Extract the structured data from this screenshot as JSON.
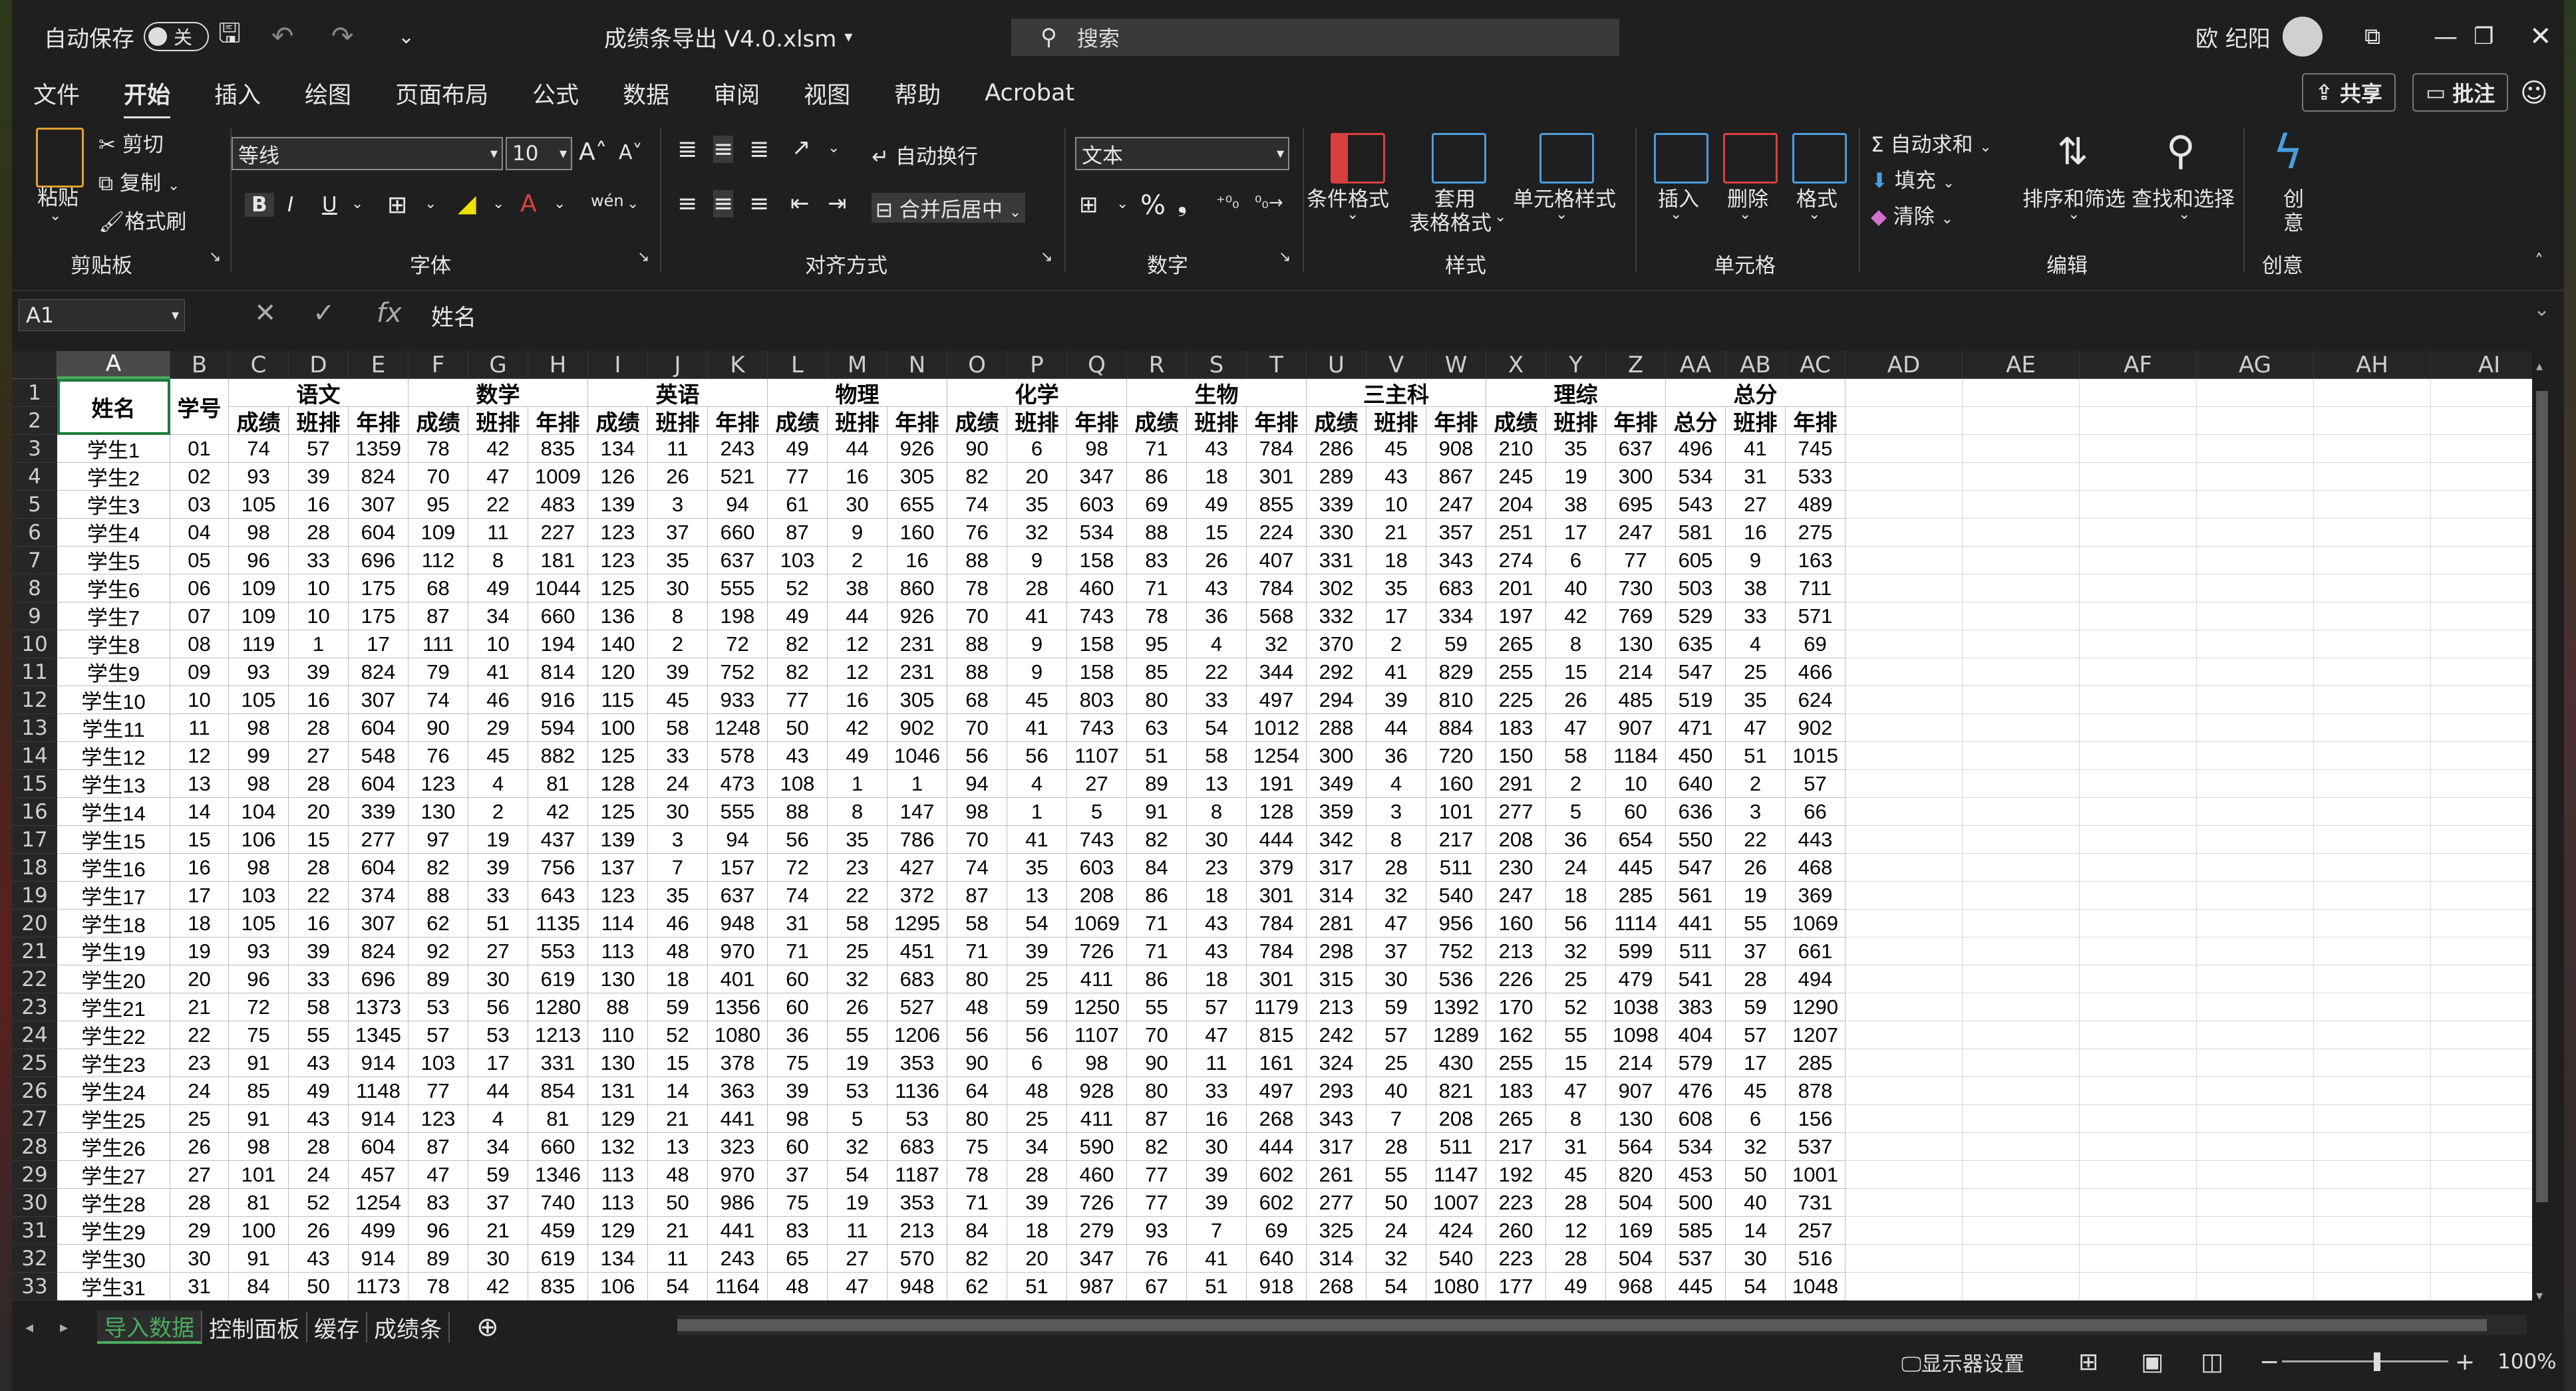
{
  "title_bar": {
    "autosave_label": "自动保存",
    "autosave_state": "关",
    "file_name": "成绩条导出 V4.0.xlsm",
    "search_placeholder": "搜索",
    "user_name": "欧 纪阳"
  },
  "menu": {
    "items": [
      "文件",
      "开始",
      "插入",
      "绘图",
      "页面布局",
      "公式",
      "数据",
      "审阅",
      "视图",
      "帮助",
      "Acrobat"
    ],
    "active": "开始",
    "share_label": "共享",
    "comments_label": "批注"
  },
  "ribbon": {
    "clipboard": {
      "paste": "粘贴",
      "cut": "剪切",
      "copy": "复制",
      "format_painter": "格式刷",
      "group": "剪贴板"
    },
    "font": {
      "name": "等线",
      "size": "10",
      "bold": "B",
      "italic": "I",
      "underline": "U",
      "phonetic": "wén",
      "group": "字体"
    },
    "alignment": {
      "wrap_text": "自动换行",
      "merge_center": "合并后居中",
      "group": "对齐方式"
    },
    "number": {
      "format": "文本",
      "percent": "%",
      "group": "数字"
    },
    "styles": {
      "conditional": "条件格式",
      "table_1": "套用",
      "table_2": "表格格式",
      "cell_styles": "单元格样式",
      "group": "样式"
    },
    "cells": {
      "insert": "插入",
      "delete": "删除",
      "format": "格式",
      "group": "单元格"
    },
    "editing": {
      "autosum": "自动求和",
      "fill": "填充",
      "clear": "清除",
      "sort_filter": "排序和筛选",
      "find_select": "查找和选择",
      "group": "编辑"
    },
    "creative": {
      "label_1": "创",
      "label_2": "意",
      "group": "创意"
    }
  },
  "formula_bar": {
    "cell_ref": "A1",
    "content": "姓名"
  },
  "columns": [
    "A",
    "B",
    "C",
    "D",
    "E",
    "F",
    "G",
    "H",
    "I",
    "J",
    "K",
    "L",
    "M",
    "N",
    "O",
    "P",
    "Q",
    "R",
    "S",
    "T",
    "U",
    "V",
    "W",
    "X",
    "Y",
    "Z",
    "AA",
    "AB",
    "AC",
    "AD",
    "AE",
    "AF",
    "AG",
    "AH",
    "AI"
  ],
  "row_numbers": [
    "1",
    "2",
    "3",
    "4",
    "5",
    "6",
    "7",
    "8",
    "9",
    "10",
    "11",
    "12",
    "13",
    "14",
    "15",
    "16",
    "17",
    "18",
    "19",
    "20",
    "21",
    "22",
    "23",
    "24",
    "25",
    "26",
    "27",
    "28",
    "29",
    "30",
    "31",
    "32",
    "33"
  ],
  "table": {
    "name_header": "姓名",
    "id_header": "学号",
    "subjects": [
      "语文",
      "数学",
      "英语",
      "物理",
      "化学",
      "生物",
      "三主科",
      "理综",
      "总分"
    ],
    "subheaders": [
      [
        "成绩",
        "班排",
        "年排"
      ],
      [
        "成绩",
        "班排",
        "年排"
      ],
      [
        "成绩",
        "班排",
        "年排"
      ],
      [
        "成绩",
        "班排",
        "年排"
      ],
      [
        "成绩",
        "班排",
        "年排"
      ],
      [
        "成绩",
        "班排",
        "年排"
      ],
      [
        "成绩",
        "班排",
        "年排"
      ],
      [
        "成绩",
        "班排",
        "年排"
      ],
      [
        "总分",
        "班排",
        "年排"
      ]
    ],
    "rows": [
      [
        "学生1",
        "01",
        "74",
        "57",
        "1359",
        "78",
        "42",
        "835",
        "134",
        "11",
        "243",
        "49",
        "44",
        "926",
        "90",
        "6",
        "98",
        "71",
        "43",
        "784",
        "286",
        "45",
        "908",
        "210",
        "35",
        "637",
        "496",
        "41",
        "745"
      ],
      [
        "学生2",
        "02",
        "93",
        "39",
        "824",
        "70",
        "47",
        "1009",
        "126",
        "26",
        "521",
        "77",
        "16",
        "305",
        "82",
        "20",
        "347",
        "86",
        "18",
        "301",
        "289",
        "43",
        "867",
        "245",
        "19",
        "300",
        "534",
        "31",
        "533"
      ],
      [
        "学生3",
        "03",
        "105",
        "16",
        "307",
        "95",
        "22",
        "483",
        "139",
        "3",
        "94",
        "61",
        "30",
        "655",
        "74",
        "35",
        "603",
        "69",
        "49",
        "855",
        "339",
        "10",
        "247",
        "204",
        "38",
        "695",
        "543",
        "27",
        "489"
      ],
      [
        "学生4",
        "04",
        "98",
        "28",
        "604",
        "109",
        "11",
        "227",
        "123",
        "37",
        "660",
        "87",
        "9",
        "160",
        "76",
        "32",
        "534",
        "88",
        "15",
        "224",
        "330",
        "21",
        "357",
        "251",
        "17",
        "247",
        "581",
        "16",
        "275"
      ],
      [
        "学生5",
        "05",
        "96",
        "33",
        "696",
        "112",
        "8",
        "181",
        "123",
        "35",
        "637",
        "103",
        "2",
        "16",
        "88",
        "9",
        "158",
        "83",
        "26",
        "407",
        "331",
        "18",
        "343",
        "274",
        "6",
        "77",
        "605",
        "9",
        "163"
      ],
      [
        "学生6",
        "06",
        "109",
        "10",
        "175",
        "68",
        "49",
        "1044",
        "125",
        "30",
        "555",
        "52",
        "38",
        "860",
        "78",
        "28",
        "460",
        "71",
        "43",
        "784",
        "302",
        "35",
        "683",
        "201",
        "40",
        "730",
        "503",
        "38",
        "711"
      ],
      [
        "学生7",
        "07",
        "109",
        "10",
        "175",
        "87",
        "34",
        "660",
        "136",
        "8",
        "198",
        "49",
        "44",
        "926",
        "70",
        "41",
        "743",
        "78",
        "36",
        "568",
        "332",
        "17",
        "334",
        "197",
        "42",
        "769",
        "529",
        "33",
        "571"
      ],
      [
        "学生8",
        "08",
        "119",
        "1",
        "17",
        "111",
        "10",
        "194",
        "140",
        "2",
        "72",
        "82",
        "12",
        "231",
        "88",
        "9",
        "158",
        "95",
        "4",
        "32",
        "370",
        "2",
        "59",
        "265",
        "8",
        "130",
        "635",
        "4",
        "69"
      ],
      [
        "学生9",
        "09",
        "93",
        "39",
        "824",
        "79",
        "41",
        "814",
        "120",
        "39",
        "752",
        "82",
        "12",
        "231",
        "88",
        "9",
        "158",
        "85",
        "22",
        "344",
        "292",
        "41",
        "829",
        "255",
        "15",
        "214",
        "547",
        "25",
        "466"
      ],
      [
        "学生10",
        "10",
        "105",
        "16",
        "307",
        "74",
        "46",
        "916",
        "115",
        "45",
        "933",
        "77",
        "16",
        "305",
        "68",
        "45",
        "803",
        "80",
        "33",
        "497",
        "294",
        "39",
        "810",
        "225",
        "26",
        "485",
        "519",
        "35",
        "624"
      ],
      [
        "学生11",
        "11",
        "98",
        "28",
        "604",
        "90",
        "29",
        "594",
        "100",
        "58",
        "1248",
        "50",
        "42",
        "902",
        "70",
        "41",
        "743",
        "63",
        "54",
        "1012",
        "288",
        "44",
        "884",
        "183",
        "47",
        "907",
        "471",
        "47",
        "902"
      ],
      [
        "学生12",
        "12",
        "99",
        "27",
        "548",
        "76",
        "45",
        "882",
        "125",
        "33",
        "578",
        "43",
        "49",
        "1046",
        "56",
        "56",
        "1107",
        "51",
        "58",
        "1254",
        "300",
        "36",
        "720",
        "150",
        "58",
        "1184",
        "450",
        "51",
        "1015"
      ],
      [
        "学生13",
        "13",
        "98",
        "28",
        "604",
        "123",
        "4",
        "81",
        "128",
        "24",
        "473",
        "108",
        "1",
        "1",
        "94",
        "4",
        "27",
        "89",
        "13",
        "191",
        "349",
        "4",
        "160",
        "291",
        "2",
        "10",
        "640",
        "2",
        "57"
      ],
      [
        "学生14",
        "14",
        "104",
        "20",
        "339",
        "130",
        "2",
        "42",
        "125",
        "30",
        "555",
        "88",
        "8",
        "147",
        "98",
        "1",
        "5",
        "91",
        "8",
        "128",
        "359",
        "3",
        "101",
        "277",
        "5",
        "60",
        "636",
        "3",
        "66"
      ],
      [
        "学生15",
        "15",
        "106",
        "15",
        "277",
        "97",
        "19",
        "437",
        "139",
        "3",
        "94",
        "56",
        "35",
        "786",
        "70",
        "41",
        "743",
        "82",
        "30",
        "444",
        "342",
        "8",
        "217",
        "208",
        "36",
        "654",
        "550",
        "22",
        "443"
      ],
      [
        "学生16",
        "16",
        "98",
        "28",
        "604",
        "82",
        "39",
        "756",
        "137",
        "7",
        "157",
        "72",
        "23",
        "427",
        "74",
        "35",
        "603",
        "84",
        "23",
        "379",
        "317",
        "28",
        "511",
        "230",
        "24",
        "445",
        "547",
        "26",
        "468"
      ],
      [
        "学生17",
        "17",
        "103",
        "22",
        "374",
        "88",
        "33",
        "643",
        "123",
        "35",
        "637",
        "74",
        "22",
        "372",
        "87",
        "13",
        "208",
        "86",
        "18",
        "301",
        "314",
        "32",
        "540",
        "247",
        "18",
        "285",
        "561",
        "19",
        "369"
      ],
      [
        "学生18",
        "18",
        "105",
        "16",
        "307",
        "62",
        "51",
        "1135",
        "114",
        "46",
        "948",
        "31",
        "58",
        "1295",
        "58",
        "54",
        "1069",
        "71",
        "43",
        "784",
        "281",
        "47",
        "956",
        "160",
        "56",
        "1114",
        "441",
        "55",
        "1069"
      ],
      [
        "学生19",
        "19",
        "93",
        "39",
        "824",
        "92",
        "27",
        "553",
        "113",
        "48",
        "970",
        "71",
        "25",
        "451",
        "71",
        "39",
        "726",
        "71",
        "43",
        "784",
        "298",
        "37",
        "752",
        "213",
        "32",
        "599",
        "511",
        "37",
        "661"
      ],
      [
        "学生20",
        "20",
        "96",
        "33",
        "696",
        "89",
        "30",
        "619",
        "130",
        "18",
        "401",
        "60",
        "32",
        "683",
        "80",
        "25",
        "411",
        "86",
        "18",
        "301",
        "315",
        "30",
        "536",
        "226",
        "25",
        "479",
        "541",
        "28",
        "494"
      ],
      [
        "学生21",
        "21",
        "72",
        "58",
        "1373",
        "53",
        "56",
        "1280",
        "88",
        "59",
        "1356",
        "60",
        "26",
        "527",
        "48",
        "59",
        "1250",
        "55",
        "57",
        "1179",
        "213",
        "59",
        "1392",
        "170",
        "52",
        "1038",
        "383",
        "59",
        "1290"
      ],
      [
        "学生22",
        "22",
        "75",
        "55",
        "1345",
        "57",
        "53",
        "1213",
        "110",
        "52",
        "1080",
        "36",
        "55",
        "1206",
        "56",
        "56",
        "1107",
        "70",
        "47",
        "815",
        "242",
        "57",
        "1289",
        "162",
        "55",
        "1098",
        "404",
        "57",
        "1207"
      ],
      [
        "学生23",
        "23",
        "91",
        "43",
        "914",
        "103",
        "17",
        "331",
        "130",
        "15",
        "378",
        "75",
        "19",
        "353",
        "90",
        "6",
        "98",
        "90",
        "11",
        "161",
        "324",
        "25",
        "430",
        "255",
        "15",
        "214",
        "579",
        "17",
        "285"
      ],
      [
        "学生24",
        "24",
        "85",
        "49",
        "1148",
        "77",
        "44",
        "854",
        "131",
        "14",
        "363",
        "39",
        "53",
        "1136",
        "64",
        "48",
        "928",
        "80",
        "33",
        "497",
        "293",
        "40",
        "821",
        "183",
        "47",
        "907",
        "476",
        "45",
        "878"
      ],
      [
        "学生25",
        "25",
        "91",
        "43",
        "914",
        "123",
        "4",
        "81",
        "129",
        "21",
        "441",
        "98",
        "5",
        "53",
        "80",
        "25",
        "411",
        "87",
        "16",
        "268",
        "343",
        "7",
        "208",
        "265",
        "8",
        "130",
        "608",
        "6",
        "156"
      ],
      [
        "学生26",
        "26",
        "98",
        "28",
        "604",
        "87",
        "34",
        "660",
        "132",
        "13",
        "323",
        "60",
        "32",
        "683",
        "75",
        "34",
        "590",
        "82",
        "30",
        "444",
        "317",
        "28",
        "511",
        "217",
        "31",
        "564",
        "534",
        "32",
        "537"
      ],
      [
        "学生27",
        "27",
        "101",
        "24",
        "457",
        "47",
        "59",
        "1346",
        "113",
        "48",
        "970",
        "37",
        "54",
        "1187",
        "78",
        "28",
        "460",
        "77",
        "39",
        "602",
        "261",
        "55",
        "1147",
        "192",
        "45",
        "820",
        "453",
        "50",
        "1001"
      ],
      [
        "学生28",
        "28",
        "81",
        "52",
        "1254",
        "83",
        "37",
        "740",
        "113",
        "50",
        "986",
        "75",
        "19",
        "353",
        "71",
        "39",
        "726",
        "77",
        "39",
        "602",
        "277",
        "50",
        "1007",
        "223",
        "28",
        "504",
        "500",
        "40",
        "731"
      ],
      [
        "学生29",
        "29",
        "100",
        "26",
        "499",
        "96",
        "21",
        "459",
        "129",
        "21",
        "441",
        "83",
        "11",
        "213",
        "84",
        "18",
        "279",
        "93",
        "7",
        "69",
        "325",
        "24",
        "424",
        "260",
        "12",
        "169",
        "585",
        "14",
        "257"
      ],
      [
        "学生30",
        "30",
        "91",
        "43",
        "914",
        "89",
        "30",
        "619",
        "134",
        "11",
        "243",
        "65",
        "27",
        "570",
        "82",
        "20",
        "347",
        "76",
        "41",
        "640",
        "314",
        "32",
        "540",
        "223",
        "28",
        "504",
        "537",
        "30",
        "516"
      ],
      [
        "学生31",
        "31",
        "84",
        "50",
        "1173",
        "78",
        "42",
        "835",
        "106",
        "54",
        "1164",
        "48",
        "47",
        "948",
        "62",
        "51",
        "987",
        "67",
        "51",
        "918",
        "268",
        "54",
        "1080",
        "177",
        "49",
        "968",
        "445",
        "54",
        "1048"
      ]
    ]
  },
  "sheet_tabs": [
    "导入数据",
    "控制面板",
    "缓存",
    "成绩条"
  ],
  "active_sheet": "导入数据",
  "status_bar": {
    "display_settings": "显示器设置",
    "zoom": "100%"
  }
}
